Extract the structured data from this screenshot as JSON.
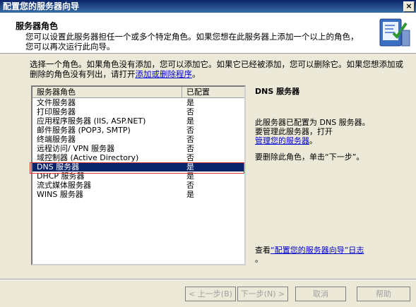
{
  "window": {
    "title": "配置您的服务器向导",
    "close_glyph": "×"
  },
  "header": {
    "title": "服务器角色",
    "subtitle": "您可以设置此服务器担任一个或多个特定角色。如果您想在此服务器上添加一个以上的角色，您可以再次运行此向导。",
    "icon": "server-config-icon"
  },
  "intro": {
    "text": "选择一个角色。如果角色没有添加，您可以添加它。如果它已经被添加，您可以删除它。如果您想添加或删除的角色没有列出，请打开",
    "link": "添加或删除程序",
    "end": "。"
  },
  "roles": {
    "col_role": "服务器角色",
    "col_configured": "已配置",
    "items": [
      {
        "name": "文件服务器",
        "configured": "是"
      },
      {
        "name": "打印服务器",
        "configured": "否"
      },
      {
        "name": "应用程序服务器 (IIS, ASP.NET)",
        "configured": "是"
      },
      {
        "name": "邮件服务器 (POP3, SMTP)",
        "configured": "否"
      },
      {
        "name": "终端服务器",
        "configured": "否"
      },
      {
        "name": "远程访问/ VPN 服务器",
        "configured": "否"
      },
      {
        "name": "域控制器 (Active Directory)",
        "configured": "否"
      },
      {
        "name": "DNS 服务器",
        "configured": "是"
      },
      {
        "name": "DHCP 服务器",
        "configured": "是"
      },
      {
        "name": "流式媒体服务器",
        "configured": "否"
      },
      {
        "name": "WINS 服务器",
        "configured": "是"
      }
    ]
  },
  "detail": {
    "title": "DNS 服务器",
    "line1": "此服务器已配置为 DNS 服务器。",
    "line2": "要管理此服务器，打开",
    "manage_link": "管理您的服务器",
    "line3": "。",
    "remove_text": "要删除此角色，单击“下一步”。",
    "log_prefix": "查看",
    "log_link": "“配置您的服务器向导”日志",
    "log_suffix": "。"
  },
  "buttons": {
    "back": "< 上一步(B)",
    "next": "下一步(N) >",
    "cancel": "取消",
    "help": "帮助"
  }
}
